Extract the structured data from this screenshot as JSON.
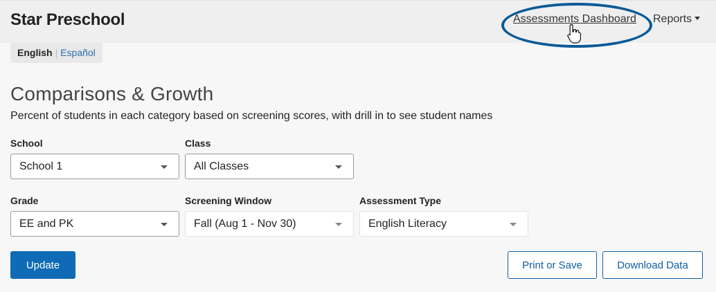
{
  "header": {
    "title": "Star Preschool",
    "nav_dashboard": "Assessments Dashboard",
    "nav_reports": "Reports"
  },
  "language": {
    "english": "English",
    "separator": "|",
    "spanish": "Español"
  },
  "page": {
    "title": "Comparisons & Growth",
    "subtitle": "Percent of students in each category based on screening scores, with drill in to see student names"
  },
  "filters": {
    "school": {
      "label": "School",
      "value": "School 1"
    },
    "class": {
      "label": "Class",
      "value": "All Classes"
    },
    "grade": {
      "label": "Grade",
      "value": "EE and PK"
    },
    "screening_window": {
      "label": "Screening Window",
      "value": "Fall (Aug 1 - Nov 30)"
    },
    "assessment_type": {
      "label": "Assessment Type",
      "value": "English Literacy"
    }
  },
  "actions": {
    "update": "Update",
    "print_or_save": "Print or Save",
    "download_data": "Download Data"
  },
  "colors": {
    "primary": "#0f6bb5",
    "highlight": "#0a5a96",
    "link": "#2a6db3"
  }
}
